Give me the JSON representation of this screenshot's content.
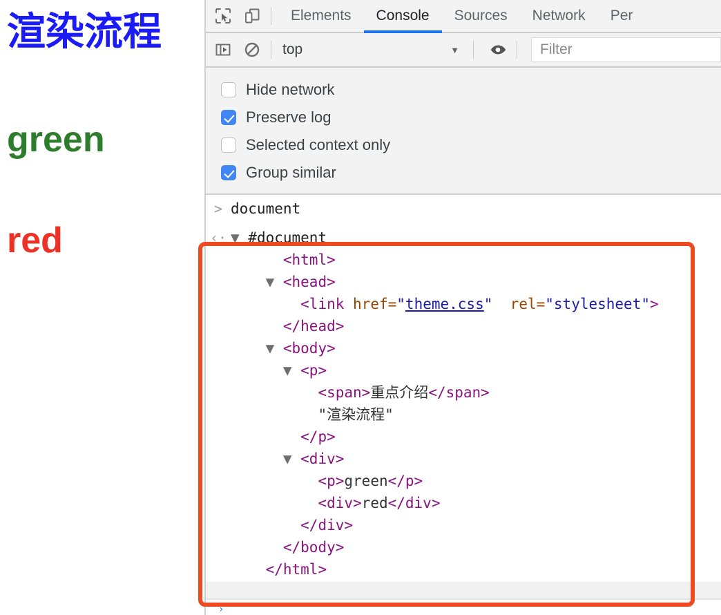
{
  "page_preview": {
    "title_text": "渲染流程",
    "title_color": "#1b1bf5",
    "green_text": "green",
    "green_color": "#2d7d2d",
    "red_text": "red",
    "red_color": "#ed3124"
  },
  "devtools": {
    "accent_color": "#1a73e8",
    "icons": {
      "inspect": "inspect-element-icon",
      "device": "device-toolbar-icon",
      "sidebar": "console-sidebar-icon",
      "clear": "clear-console-icon",
      "eye": "live-expression-icon"
    },
    "tabs": [
      {
        "label": "Elements",
        "active": false
      },
      {
        "label": "Console",
        "active": true
      },
      {
        "label": "Sources",
        "active": false
      },
      {
        "label": "Network",
        "active": false
      },
      {
        "label": "Per",
        "active": false
      }
    ],
    "toolbar": {
      "context_value": "top",
      "caret": "▼",
      "filter_placeholder": "Filter",
      "filter_value": ""
    },
    "settings": [
      {
        "label": "Hide network",
        "checked": false
      },
      {
        "label": "Preserve log",
        "checked": true
      },
      {
        "label": "Selected context only",
        "checked": false
      },
      {
        "label": "Group similar",
        "checked": true
      }
    ],
    "console": {
      "prompt_symbol": ">",
      "command": "document",
      "result_symbol": "‹·",
      "dom": {
        "root_arrow": "▼",
        "root_label": "#document",
        "lines": [
          {
            "indent": 1,
            "arrow": "",
            "tokens": [
              {
                "t": "tag",
                "v": "<html>"
              }
            ]
          },
          {
            "indent": 1,
            "arrow": "▼",
            "tokens": [
              {
                "t": "tag",
                "v": "<head>"
              }
            ]
          },
          {
            "indent": 2,
            "arrow": "",
            "tokens": [
              {
                "t": "tag",
                "v": "<link"
              },
              {
                "t": "sp",
                "v": " "
              },
              {
                "t": "attr",
                "v": "href"
              },
              {
                "t": "punct2",
                "v": "="
              },
              {
                "t": "val",
                "v": "\""
              },
              {
                "t": "link",
                "v": "theme.css"
              },
              {
                "t": "val",
                "v": "\""
              },
              {
                "t": "sp",
                "v": "  "
              },
              {
                "t": "attr",
                "v": "rel"
              },
              {
                "t": "punct2",
                "v": "="
              },
              {
                "t": "val",
                "v": "\"stylesheet\""
              },
              {
                "t": "tag",
                "v": ">"
              }
            ]
          },
          {
            "indent": 1,
            "arrow": "",
            "tokens": [
              {
                "t": "tag",
                "v": "</head>"
              }
            ]
          },
          {
            "indent": 1,
            "arrow": "▼",
            "tokens": [
              {
                "t": "tag",
                "v": "<body>"
              }
            ]
          },
          {
            "indent": 2,
            "arrow": "▼",
            "tokens": [
              {
                "t": "tag",
                "v": "<p>"
              }
            ]
          },
          {
            "indent": 3,
            "arrow": "",
            "tokens": [
              {
                "t": "tag",
                "v": "<span>"
              },
              {
                "t": "text",
                "v": "重点介绍"
              },
              {
                "t": "tag",
                "v": "</span>"
              }
            ]
          },
          {
            "indent": 3,
            "arrow": "",
            "tokens": [
              {
                "t": "text",
                "v": "\"渲染流程\""
              }
            ]
          },
          {
            "indent": 2,
            "arrow": "",
            "tokens": [
              {
                "t": "tag",
                "v": "</p>"
              }
            ]
          },
          {
            "indent": 2,
            "arrow": "▼",
            "tokens": [
              {
                "t": "tag",
                "v": "<div>"
              }
            ]
          },
          {
            "indent": 3,
            "arrow": "",
            "tokens": [
              {
                "t": "tag",
                "v": "<p>"
              },
              {
                "t": "text",
                "v": "green"
              },
              {
                "t": "tag",
                "v": "</p>"
              }
            ]
          },
          {
            "indent": 3,
            "arrow": "",
            "tokens": [
              {
                "t": "tag",
                "v": "<div>"
              },
              {
                "t": "text",
                "v": "red"
              },
              {
                "t": "tag",
                "v": "</div>"
              }
            ]
          },
          {
            "indent": 2,
            "arrow": "",
            "tokens": [
              {
                "t": "tag",
                "v": "</div>"
              }
            ]
          },
          {
            "indent": 1,
            "arrow": "",
            "tokens": [
              {
                "t": "tag",
                "v": "</body>"
              }
            ]
          },
          {
            "indent": 0,
            "arrow": "",
            "tokens": [
              {
                "t": "tag",
                "v": "</html>"
              }
            ]
          }
        ]
      }
    },
    "annotation": {
      "shape": "rounded-rectangle",
      "color": "#ee4a22"
    },
    "bottom_prompt": "›"
  }
}
